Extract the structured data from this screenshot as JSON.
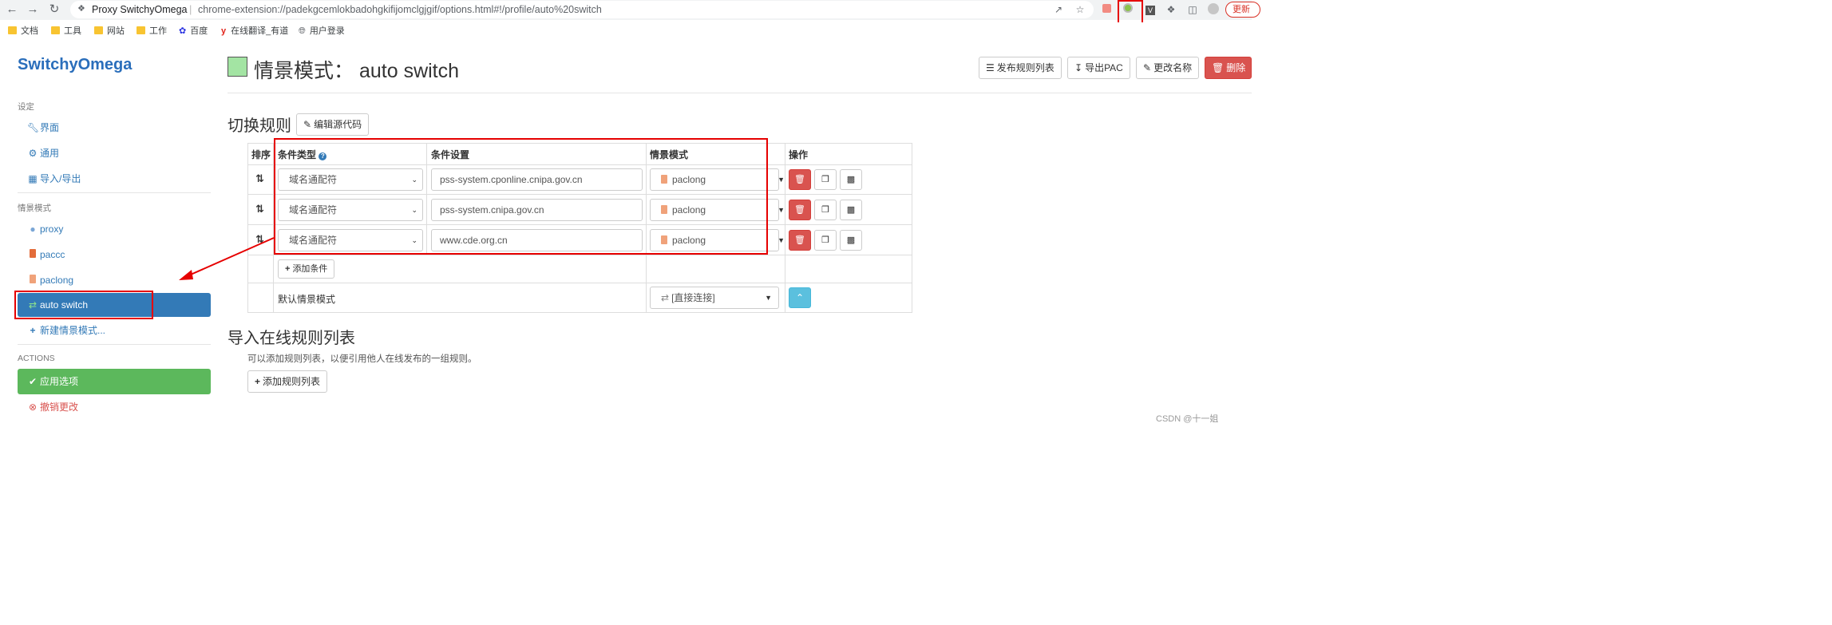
{
  "browser": {
    "tab_title": "Proxy SwitchyOmega",
    "url": "chrome-extension://padekgcemlokbadohgkifijomclgjgif/options.html#!/profile/auto%20switch",
    "update_label": "更新"
  },
  "bookmarks": [
    {
      "label": "文档",
      "icon": "folder-icon"
    },
    {
      "label": "工具",
      "icon": "folder-icon"
    },
    {
      "label": "网站",
      "icon": "folder-icon"
    },
    {
      "label": "工作",
      "icon": "folder-icon"
    },
    {
      "label": "百度",
      "icon": "baidu-icon"
    },
    {
      "label": "在线翻译_有道",
      "icon": "youdao-icon"
    },
    {
      "label": "用户登录",
      "icon": "globe-icon"
    }
  ],
  "sidebar": {
    "brand": "SwitchyOmega",
    "settings_header": "设定",
    "settings_items": [
      {
        "label": "界面",
        "icon": "wrench-icon"
      },
      {
        "label": "通用",
        "icon": "gear-icon"
      },
      {
        "label": "导入/导出",
        "icon": "floppy-icon"
      }
    ],
    "profiles_header": "情景模式",
    "profiles": [
      {
        "label": "proxy",
        "icon": "globe-icon"
      },
      {
        "label": "paccc",
        "icon": "file-icon"
      },
      {
        "label": "paclong",
        "icon": "file-icon"
      },
      {
        "label": "auto switch",
        "icon": "switch-icon",
        "active": true
      }
    ],
    "new_profile": "新建情景模式...",
    "actions_header": "ACTIONS",
    "apply": "应用选项",
    "discard": "撤销更改"
  },
  "main": {
    "title_prefix": "情景模式：",
    "title_name": "auto switch",
    "swatch_color": "#a3e4a3",
    "header_buttons": {
      "publish": "发布规则列表",
      "export_pac": "导出PAC",
      "rename": "更改名称",
      "delete": "删除"
    },
    "rules_section_title": "切换规则",
    "edit_source": "编辑源代码",
    "table_headers": {
      "sort": "排序",
      "condition_type": "条件类型",
      "condition_setting": "条件设置",
      "profile": "情景模式",
      "actions": "操作"
    },
    "rules": [
      {
        "condition_type": "域名通配符",
        "condition": "pss-system.cponline.cnipa.gov.cn",
        "profile": "paclong"
      },
      {
        "condition_type": "域名通配符",
        "condition": "pss-system.cnipa.gov.cn",
        "profile": "paclong"
      },
      {
        "condition_type": "域名通配符",
        "condition": "www.cde.org.cn",
        "profile": "paclong"
      }
    ],
    "add_condition": "添加条件",
    "default_label": "默认情景模式",
    "default_profile": "[直接连接]",
    "online_section_title": "导入在线规则列表",
    "online_desc": "可以添加规则列表，以便引用他人在线发布的一组规则。",
    "add_rule_list": "添加规则列表"
  },
  "watermark": "CSDN @十一姐",
  "colors": {
    "brand": "#2a6ebb",
    "active_item": "#337ab7",
    "apply": "#5cb85c",
    "danger": "#d9534f",
    "annotation": "#e60000"
  }
}
